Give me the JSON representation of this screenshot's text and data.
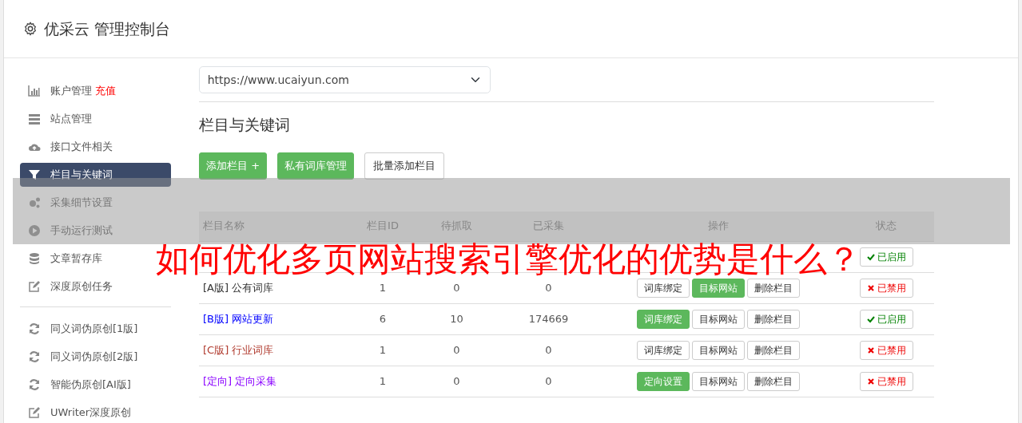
{
  "header": {
    "title": "优采云 管理控制台"
  },
  "sidebar": {
    "groups": [
      {
        "items": [
          {
            "label": "账户管理",
            "badge": "充值",
            "selected": false
          },
          {
            "label": "站点管理",
            "selected": false
          },
          {
            "label": "接口文件相关",
            "selected": false
          },
          {
            "label": "栏目与关键词",
            "selected": true
          },
          {
            "label": "采集细节设置",
            "selected": false
          },
          {
            "label": "手动运行测试",
            "selected": false
          },
          {
            "label": "文章暂存库",
            "selected": false
          },
          {
            "label": "深度原创任务",
            "selected": false
          }
        ]
      },
      {
        "items": [
          {
            "label": "同义词伪原创[1版]",
            "selected": false
          },
          {
            "label": "同义词伪原创[2版]",
            "selected": false
          },
          {
            "label": "智能伪原创[AI版]",
            "selected": false
          },
          {
            "label": "UWriter深度原创",
            "selected": false
          }
        ]
      }
    ]
  },
  "site_select": {
    "value": "https://www.ucaiyun.com"
  },
  "section_title": "栏目与关键词",
  "toolbar": [
    {
      "label": "添加栏目 +",
      "highlighted": true
    },
    {
      "label": "私有词库管理",
      "highlighted": true
    },
    {
      "label": "批量添加栏目",
      "highlighted": false
    }
  ],
  "table": {
    "columns": [
      "栏目名称",
      "栏目ID",
      "待抓取",
      "已采集",
      "操作",
      "状态"
    ],
    "rows": [
      {
        "status": {
          "label": "已启用",
          "enabled": true
        }
      },
      {
        "name": "[A版] 公有词库",
        "color": "#333333",
        "id": "1",
        "pending": "0",
        "collected": "0",
        "actions": [
          {
            "label": "词库绑定",
            "highlighted": false
          },
          {
            "label": "目标网站",
            "highlighted": true
          },
          {
            "label": "删除栏目",
            "highlighted": false
          }
        ],
        "status": {
          "label": "已禁用",
          "enabled": false
        }
      },
      {
        "name": "[B版] 网站更新",
        "color": "#0000ff",
        "id": "6",
        "pending": "10",
        "collected": "174669",
        "actions": [
          {
            "label": "词库绑定",
            "highlighted": true
          },
          {
            "label": "目标网站",
            "highlighted": false
          },
          {
            "label": "删除栏目",
            "highlighted": false
          }
        ],
        "status": {
          "label": "已启用",
          "enabled": true
        }
      },
      {
        "name": "[C版] 行业词库",
        "color": "#b03a2e",
        "id": "1",
        "pending": "0",
        "collected": "0",
        "actions": [
          {
            "label": "词库绑定",
            "highlighted": false
          },
          {
            "label": "目标网站",
            "highlighted": false
          },
          {
            "label": "删除栏目",
            "highlighted": false
          }
        ],
        "status": {
          "label": "已禁用",
          "enabled": false
        }
      },
      {
        "name": "[定向] 定向采集",
        "color": "#8a00ff",
        "id": "1",
        "pending": "0",
        "collected": "0",
        "actions": [
          {
            "label": "定向设置",
            "highlighted": true
          },
          {
            "label": "目标网站",
            "highlighted": false
          },
          {
            "label": "删除栏目",
            "highlighted": false
          }
        ],
        "status": {
          "label": "已禁用",
          "enabled": false
        }
      }
    ]
  },
  "overlay": {
    "headline": "如何优化多页网站搜索引擎优化的优势是什么？"
  }
}
